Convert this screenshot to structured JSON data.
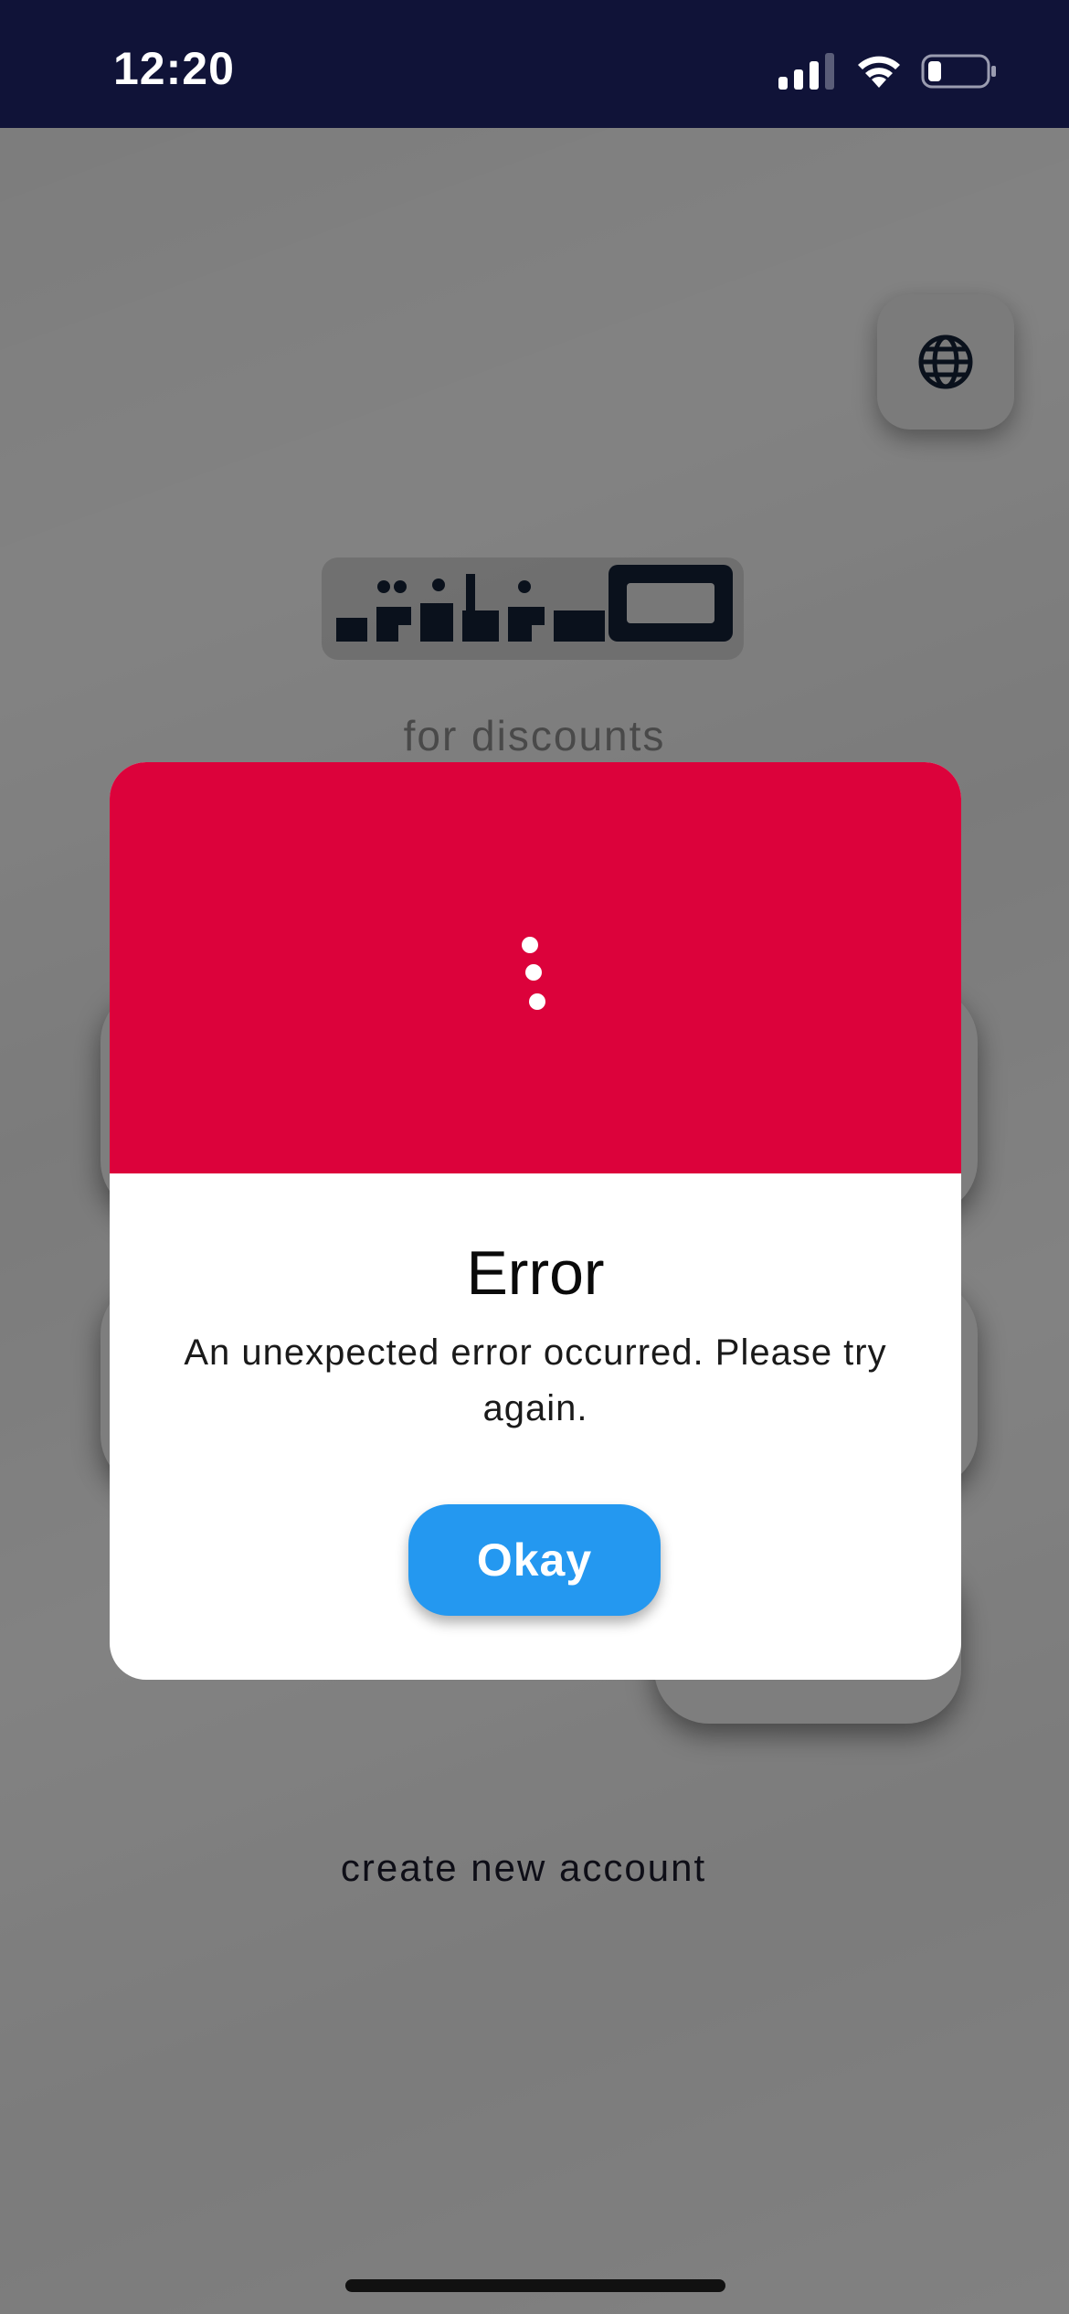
{
  "status_bar": {
    "time": "12:20",
    "icons": [
      "signal-icon",
      "wifi-icon",
      "battery-icon"
    ]
  },
  "background": {
    "language_button_icon": "globe-icon",
    "brand": "حفظة",
    "tagline": "for discounts",
    "create_account_link": "create new account"
  },
  "dialog": {
    "header_color": "#dc023b",
    "header_icon": "vertical-dots-icon",
    "title": "Error",
    "message": "An unexpected error occurred. Please try again.",
    "button_label": "Okay",
    "button_color": "#2498f0"
  },
  "colors": {
    "status_bar_bg": "#101338",
    "overlay": "rgba(0,0,0,0.47)",
    "logo_navy": "#142036"
  }
}
